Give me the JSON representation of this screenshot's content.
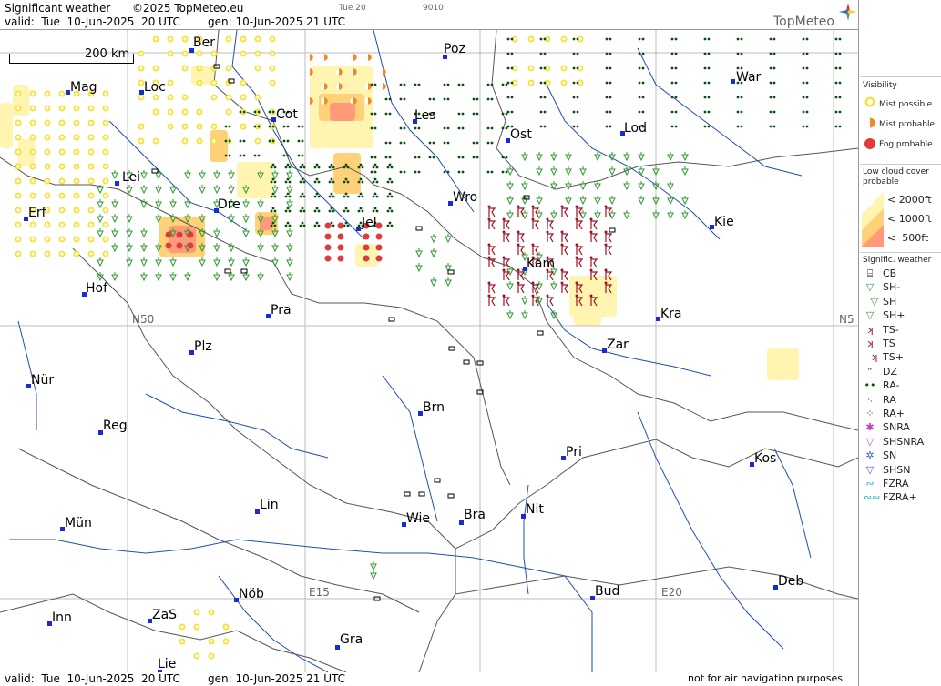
{
  "header": {
    "title": "Significant weather",
    "copyright": "©2025 TopMeteo.eu",
    "tab_label": "Tue 20",
    "code": "9010",
    "valid": "valid:  Tue  10-Jun-2025  20 UTC",
    "gen": "gen: 10-Jun-2025 21 UTC",
    "logo": "TopMeteo"
  },
  "footer": {
    "valid": "valid:  Tue  10-Jun-2025  20 UTC",
    "gen": "gen: 10-Jun-2025 21 UTC",
    "disclaimer": "not for air navigation purposes"
  },
  "map": {
    "scale_label": "200 km",
    "grid_labels": {
      "n50_left": "N50",
      "n50_right": "N5",
      "e15": "E15",
      "e20": "E20"
    },
    "cities": [
      "Ber",
      "Poz",
      "War",
      "Mag",
      "Loc",
      "Cot",
      "Les",
      "Lod",
      "Ost",
      "Lei",
      "Erf",
      "Dre",
      "Wro",
      "Jel",
      "Kie",
      "Kam",
      "Hof",
      "Pra",
      "Kra",
      "Plz",
      "Zar",
      "Nür",
      "Brn",
      "Reg",
      "Pri",
      "Kos",
      "Lin",
      "Nit",
      "Wie",
      "Bra",
      "Mün",
      "Nöb",
      "Bud",
      "Deb",
      "Inn",
      "ZaS",
      "Gra",
      "Lie"
    ]
  },
  "legend": {
    "visibility": {
      "title": "Visibility",
      "items": [
        "Mist possible",
        "Mist probable",
        "Fog probable"
      ]
    },
    "low_cloud": {
      "title": "Low cloud cover\nprobable",
      "items": [
        "< 2000ft",
        "< 1000ft",
        "<  500ft"
      ]
    },
    "signific": {
      "title": "Signific. weather",
      "items": [
        {
          "icon": "cb-icon",
          "label": "CB"
        },
        {
          "icon": "shower-light-icon",
          "label": "SH-"
        },
        {
          "icon": "shower-icon",
          "label": "SH"
        },
        {
          "icon": "shower-heavy-icon",
          "label": "SH+"
        },
        {
          "icon": "thunderstorm-light-icon",
          "label": "TS-"
        },
        {
          "icon": "thunderstorm-icon",
          "label": "TS"
        },
        {
          "icon": "thunderstorm-heavy-icon",
          "label": "TS+"
        },
        {
          "icon": "drizzle-icon",
          "label": "DZ"
        },
        {
          "icon": "rain-light-icon",
          "label": "RA-"
        },
        {
          "icon": "rain-icon",
          "label": "RA"
        },
        {
          "icon": "rain-heavy-icon",
          "label": "RA+"
        },
        {
          "icon": "snow-rain-icon",
          "label": "SNRA"
        },
        {
          "icon": "snow-rain-shower-icon",
          "label": "SHSNRA"
        },
        {
          "icon": "snow-icon",
          "label": "SN"
        },
        {
          "icon": "snow-shower-icon",
          "label": "SHSN"
        },
        {
          "icon": "freezing-rain-icon",
          "label": "FZRA"
        },
        {
          "icon": "freezing-rain-heavy-icon",
          "label": "FZRA+"
        }
      ]
    }
  },
  "colors": {
    "mist_possible": "#f5e23a",
    "mist_probable": "#f08a24",
    "fog_probable": "#e03a3a",
    "cloud_2000": "#fff5b0",
    "cloud_1000": "#ffd27a",
    "cloud_500": "#ff9a7a",
    "shower": "#2e9a2e",
    "rain": "#0a4d0a",
    "thunder": "#a01020",
    "city": "#1a2bd6"
  }
}
